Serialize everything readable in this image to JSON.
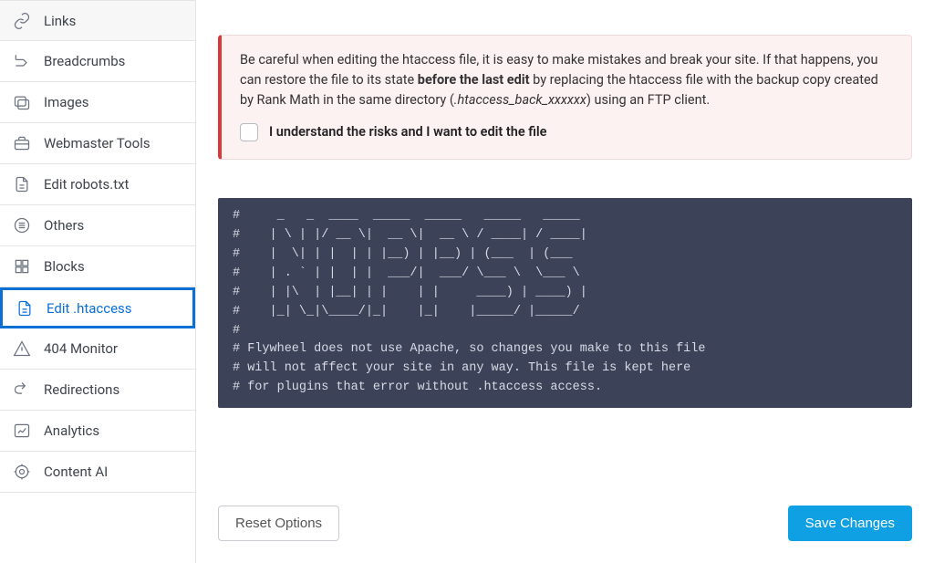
{
  "sidebar": {
    "items": [
      {
        "label": "Links",
        "icon": "links-icon"
      },
      {
        "label": "Breadcrumbs",
        "icon": "breadcrumbs-icon"
      },
      {
        "label": "Images",
        "icon": "images-icon"
      },
      {
        "label": "Webmaster Tools",
        "icon": "toolbox-icon"
      },
      {
        "label": "Edit robots.txt",
        "icon": "file-text-icon"
      },
      {
        "label": "Others",
        "icon": "list-icon"
      },
      {
        "label": "Blocks",
        "icon": "blocks-icon"
      },
      {
        "label": "Edit .htaccess",
        "icon": "file-text-icon",
        "active": true
      },
      {
        "label": "404 Monitor",
        "icon": "warning-icon"
      },
      {
        "label": "Redirections",
        "icon": "redirections-icon"
      },
      {
        "label": "Analytics",
        "icon": "analytics-icon"
      },
      {
        "label": "Content AI",
        "icon": "ai-icon"
      }
    ]
  },
  "alert": {
    "text_before_bold": "Be careful when editing the htaccess file, it is easy to make mistakes and break your site. If that happens, you can restore the file to its state ",
    "bold_phrase": "before the last edit",
    "text_after_bold": " by replacing the htaccess file with the backup copy created by Rank Math in the same directory (",
    "italic_phrase": ".htaccess_back_xxxxxx",
    "text_after_italic": ") using an FTP client.",
    "checkbox_label": "I understand the risks and I want to edit the file",
    "checkbox_checked": false
  },
  "code": {
    "content": "#     _   _  ____  _____  _____   _____   _____\n#    | \\ | |/ __ \\|  __ \\|  __ \\ / ____| / ____|\n#    |  \\| | |  | | |__) | |__) | (___  | (___\n#    | . ` | |  | |  ___/|  ___/ \\___ \\  \\___ \\\n#    | |\\  | |__| | |    | |     ____) | ____) |\n#    |_| \\_|\\____/|_|    |_|    |_____/ |_____/\n#\n# Flywheel does not use Apache, so changes you make to this file\n# will not affect your site in any way. This file is kept here\n# for plugins that error without .htaccess access."
  },
  "footer": {
    "reset_label": "Reset Options",
    "save_label": "Save Changes"
  },
  "colors": {
    "accent": "#0ea0e3",
    "active_border": "#0b6fd6",
    "alert_bg": "#fdf2f2",
    "alert_border_left": "#d83a3a",
    "code_bg": "#3c4257"
  }
}
